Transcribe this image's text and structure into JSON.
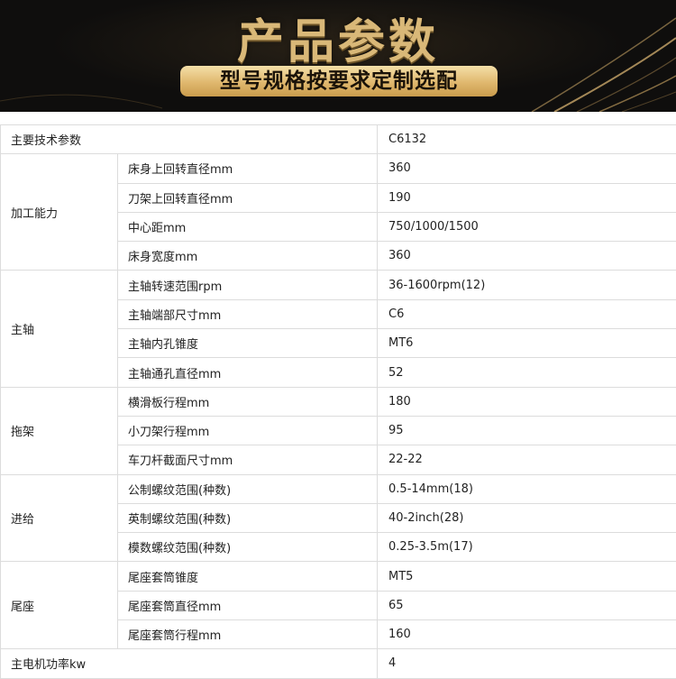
{
  "banner": {
    "title": "产品参数",
    "subtitle": "型号规格按要求定制选配"
  },
  "table": {
    "header": {
      "label": "主要技术参数",
      "value": "C6132"
    },
    "groups": [
      {
        "name": "加工能力",
        "rows": [
          {
            "label": "床身上回转直径mm",
            "value": "360"
          },
          {
            "label": "刀架上回转直径mm",
            "value": "190"
          },
          {
            "label": "中心距mm",
            "value": "750/1000/1500"
          },
          {
            "label": "床身宽度mm",
            "value": "360"
          }
        ]
      },
      {
        "name": "主轴",
        "rows": [
          {
            "label": "主轴转速范围rpm",
            "value": "36-1600rpm(12)"
          },
          {
            "label": "主轴端部尺寸mm",
            "value": "C6"
          },
          {
            "label": "主轴内孔锥度",
            "value": "MT6"
          },
          {
            "label": "主轴通孔直径mm",
            "value": "52"
          }
        ]
      },
      {
        "name": "拖架",
        "rows": [
          {
            "label": "横滑板行程mm",
            "value": "180"
          },
          {
            "label": "小刀架行程mm",
            "value": "95"
          },
          {
            "label": "车刀杆截面尺寸mm",
            "value": "22-22"
          }
        ]
      },
      {
        "name": "进给",
        "rows": [
          {
            "label": "公制螺纹范围(种数)",
            "value": "0.5-14mm(18)"
          },
          {
            "label": "英制螺纹范围(种数)",
            "value": "40-2inch(28)"
          },
          {
            "label": "模数螺纹范围(种数)",
            "value": "0.25-3.5m(17)"
          }
        ]
      },
      {
        "name": "尾座",
        "rows": [
          {
            "label": "尾座套筒锥度",
            "value": "MT5"
          },
          {
            "label": "尾座套筒直径mm",
            "value": "65"
          },
          {
            "label": "尾座套筒行程mm",
            "value": "160"
          }
        ]
      }
    ],
    "footer": {
      "label": "主电机功率kw",
      "value": "4"
    }
  },
  "colors": {
    "banner_bg": "#0f0e0d",
    "gold": "#d9b878",
    "border": "#dcdcdc"
  }
}
